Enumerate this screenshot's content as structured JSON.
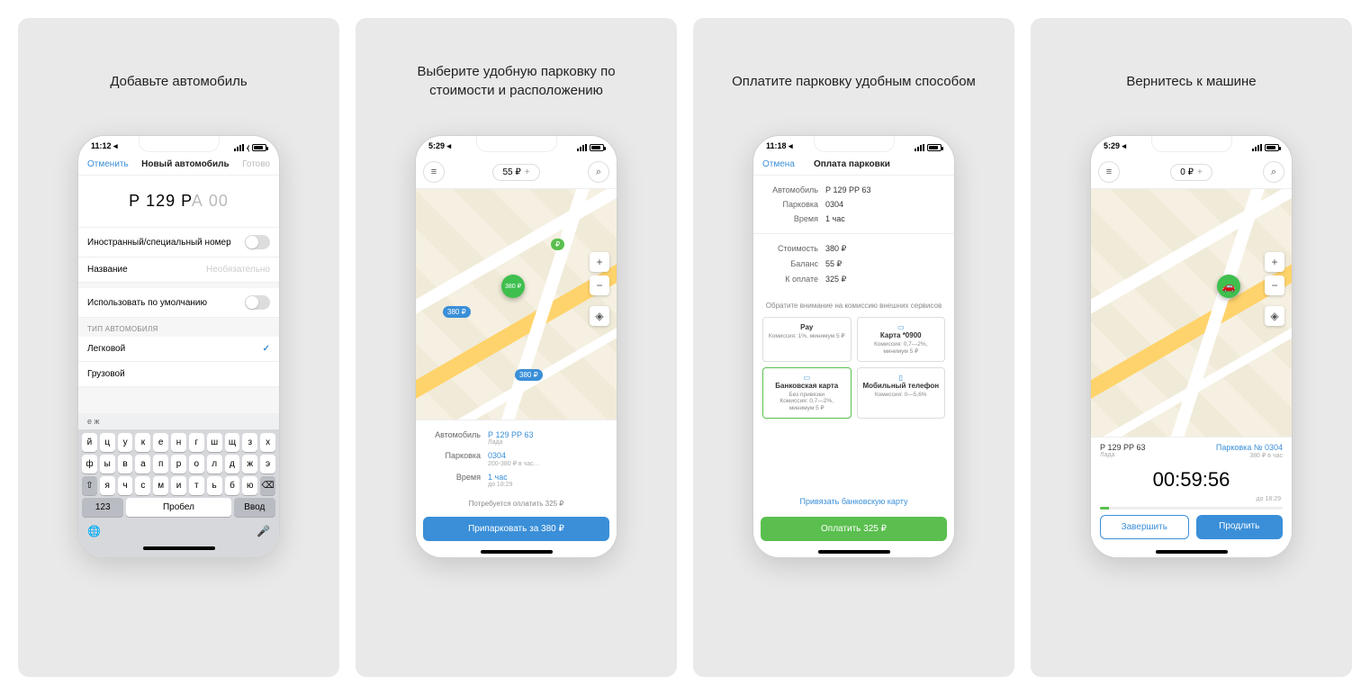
{
  "panels": [
    {
      "caption": "Добавьте автомобиль"
    },
    {
      "caption": "Выберите удобную парковку по стоимости и расположению"
    },
    {
      "caption": "Оплатите парковку удобным способом"
    },
    {
      "caption": "Вернитесь к машине"
    }
  ],
  "status": {
    "t1": "11:12 ◂",
    "t2": "5:29 ◂",
    "t3": "11:18 ◂",
    "t4": "5:29 ◂"
  },
  "screen1": {
    "cancel": "Отменить",
    "title": "Новый автомобиль",
    "done": "Готово",
    "plate_main": "Р 129 Р",
    "plate_dim": "А 00",
    "foreign": "Иностранный/специальный номер",
    "name_label": "Название",
    "name_placeholder": "Необязательно",
    "default": "Использовать по умолчанию",
    "type_header": "ТИП АВТОМОБИЛЯ",
    "type_car": "Легковой",
    "type_truck": "Грузовой",
    "hint": "е ж",
    "kb_row1": [
      "й",
      "ц",
      "у",
      "к",
      "е",
      "н",
      "г",
      "ш",
      "щ",
      "з",
      "х"
    ],
    "kb_row2": [
      "ф",
      "ы",
      "в",
      "а",
      "п",
      "р",
      "о",
      "л",
      "д",
      "ж",
      "э"
    ],
    "kb_row3": [
      "я",
      "ч",
      "с",
      "м",
      "и",
      "т",
      "ь",
      "б",
      "ю"
    ],
    "shift": "⇧",
    "backspace": "⌫",
    "kb_123": "123",
    "kb_space": "Пробел",
    "kb_enter": "Ввод",
    "globe": "🌐",
    "mic": "🎤"
  },
  "screen2": {
    "balance": "55 ₽",
    "plus": "+",
    "menu": "≡",
    "search": "⌕",
    "pin_price": "380 ₽",
    "bubble1": "380 ₽",
    "bubble2": "₽",
    "bubble3": "380 ₽",
    "kv_car_k": "Автомобиль",
    "kv_car_v": "Р 129 РР 63",
    "kv_car_sub": "Лада",
    "kv_park_k": "Парковка",
    "kv_park_v": "0304",
    "kv_park_sub": "200-380 ₽ в час…",
    "kv_time_k": "Время",
    "kv_time_v": "1 час",
    "kv_time_sub": "до 18:29",
    "note": "Потребуется оплатить 325 ₽",
    "action": "Припарковать за 380 ₽"
  },
  "screen3": {
    "cancel": "Отмена",
    "title": "Оплата парковки",
    "kv_car_k": "Автомобиль",
    "kv_car_v": "Р 129 РР 63",
    "kv_park_k": "Парковка",
    "kv_park_v": "0304",
    "kv_time_k": "Время",
    "kv_time_v": "1 час",
    "kv_cost_k": "Стоимость",
    "kv_cost_v": "380 ₽",
    "kv_bal_k": "Баланс",
    "kv_bal_v": "55 ₽",
    "kv_due_k": "К оплате",
    "kv_due_v": "325 ₽",
    "fee_note": "Обратите внимание на комиссию внешних сервисов",
    "pay1_t": " Pay",
    "pay1_c": "Комиссия: 1%, минимум 5 ₽",
    "pay2_t": "Карта *0900",
    "pay2_c": "Комиссия: 0,7—2%, минимум 5 ₽",
    "pay3_t": "Банковская карта",
    "pay3_c": "Без привязки\nКомиссия: 0,7—2%, минимум 5 ₽",
    "pay4_t": "Мобильный телефон",
    "pay4_c": "Комиссия: 0—5,6%",
    "link": "Привязать банковскую карту",
    "action": "Оплатить 325 ₽"
  },
  "screen4": {
    "balance": "0 ₽",
    "plate": "Р 129 РР 63",
    "plate_sub": "Лада",
    "park": "Парковка № 0304",
    "park_sub": "380 ₽ в час",
    "timer": "00:59:56",
    "until": "до 18:29",
    "end": "Завершить",
    "extend": "Продлить"
  }
}
